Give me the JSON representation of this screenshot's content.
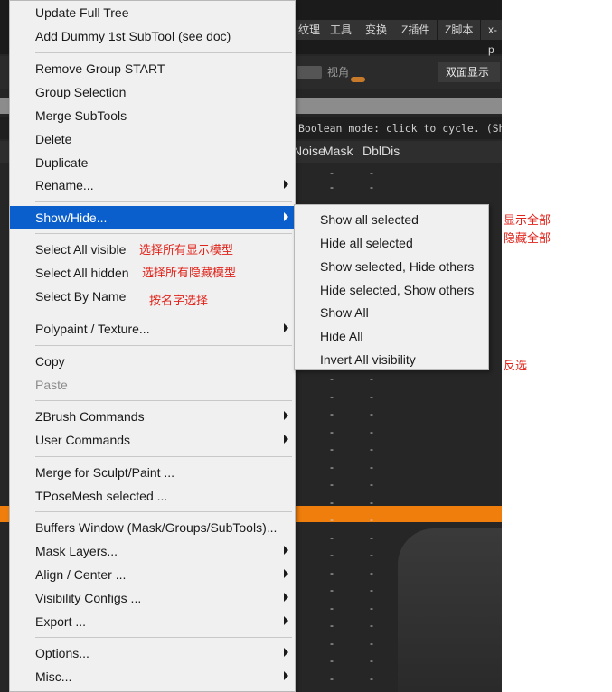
{
  "background": {
    "top_menus": [
      "纹理",
      "工具",
      "变换",
      "Z插件",
      "Z脚本",
      "x-p"
    ],
    "view_label": "视角",
    "double_sided": "双面显示",
    "status_text": "Boolean mode: click to cycle. (Shif",
    "column_headers": [
      "Noise",
      "Mask",
      "DblDis"
    ],
    "cell_value": "-"
  },
  "menu": {
    "update_full_tree": "Update Full Tree",
    "add_dummy": "Add Dummy 1st SubTool (see doc)",
    "remove_group_start": "Remove Group START",
    "group_selection": "Group Selection",
    "merge_subtools": "Merge SubTools",
    "delete": "Delete",
    "duplicate": "Duplicate",
    "rename": "Rename...",
    "show_hide": "Show/Hide...",
    "select_all_visible": "Select All visible",
    "select_all_hidden": "Select All hidden",
    "select_by_name": "Select By Name",
    "polypaint_texture": "Polypaint / Texture...",
    "copy": "Copy",
    "paste": "Paste",
    "zbrush_commands": "ZBrush Commands",
    "user_commands": "User Commands",
    "merge_for_sculpt": "Merge for Sculpt/Paint ...",
    "tposemesh_selected": "TPoseMesh selected ...",
    "buffers_window": "Buffers Window (Mask/Groups/SubTools)...",
    "mask_layers": "Mask Layers...",
    "align_center": "Align / Center ...",
    "visibility_configs": "Visibility Configs ...",
    "export": "Export ...",
    "options": "Options...",
    "misc": "Misc..."
  },
  "annotations": {
    "select_all_visible": "选择所有显示模型",
    "select_all_hidden": "选择所有隐藏模型",
    "select_by_name": "按名字选择",
    "show_all": "显示全部",
    "hide_all": "隐藏全部",
    "invert": "反选"
  },
  "submenu": {
    "show_all_selected": "Show all selected",
    "hide_all_selected": "Hide all selected",
    "show_selected_hide_others": "Show selected, Hide others",
    "hide_selected_show_others": "Hide selected, Show others",
    "show_all": "Show All",
    "hide_all": "Hide All",
    "invert_all_visibility": "Invert All visibility"
  },
  "colors": {
    "highlight": "#0b5fcc",
    "annotation": "#e0241b",
    "selected_row": "#f07e0c"
  }
}
